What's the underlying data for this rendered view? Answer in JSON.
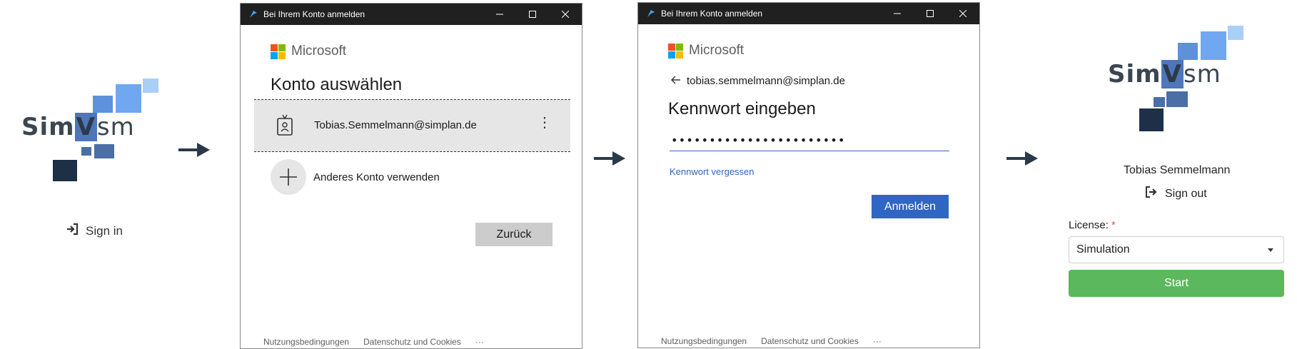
{
  "colors": {
    "arrow": "#2b3a4a",
    "ms_red": "#f25022",
    "ms_green": "#7fba00",
    "ms_blue": "#00a4ef",
    "ms_yellow": "#ffb900",
    "primary_blue": "#2f66c4",
    "start_green": "#5cb85c",
    "required_red": "#d9534f"
  },
  "panel1": {
    "logo": {
      "part1": "Sim",
      "part2": "V",
      "part3": "sm"
    },
    "signin_label": "Sign in",
    "signin_icon": "sign-in-icon"
  },
  "dialog1": {
    "window_title": "Bei Ihrem Konto anmelden",
    "brand": "Microsoft",
    "heading": "Konto auswählen",
    "account_email": "Tobias.Semmelmann@simplan.de",
    "account_more": "⋮",
    "other_account": "Anderes Konto verwenden",
    "back_button": "Zurück",
    "footer": {
      "terms": "Nutzungsbedingungen",
      "privacy": "Datenschutz und Cookies",
      "more": "···"
    }
  },
  "dialog2": {
    "window_title": "Bei Ihrem Konto anmelden",
    "brand": "Microsoft",
    "back_email": "tobias.semmelmann@simplan.de",
    "heading": "Kennwort eingeben",
    "password_value": "•••••••••••••••••••••••",
    "forgot_link": "Kennwort vergessen",
    "signin_button": "Anmelden",
    "footer": {
      "terms": "Nutzungsbedingungen",
      "privacy": "Datenschutz und Cookies",
      "more": "···"
    }
  },
  "panel4": {
    "logo": {
      "part1": "Sim",
      "part2": "V",
      "part3": "sm"
    },
    "user_name": "Tobias Semmelmann",
    "signout_label": "Sign out",
    "license_label": "License:",
    "license_required": "*",
    "license_selected": "Simulation",
    "start_button": "Start"
  }
}
